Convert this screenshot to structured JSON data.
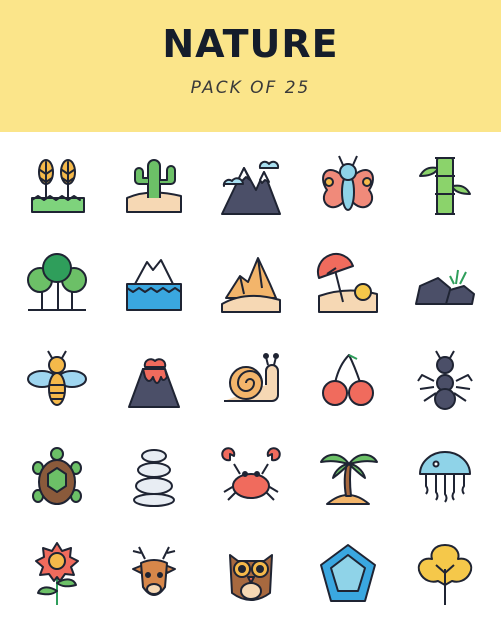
{
  "header": {
    "title": "NATURE",
    "subtitle": "PACK OF 25"
  },
  "colors": {
    "banner": "#fbe58a",
    "outline": "#1f2433",
    "background": "#ffffff"
  },
  "icons": [
    [
      "wheat-icon",
      "cactus-icon",
      "mountain-icon",
      "butterfly-icon",
      "bamboo-icon"
    ],
    [
      "forest-icon",
      "iceberg-icon",
      "desert-dunes-icon",
      "beach-umbrella-icon",
      "rocks-icon"
    ],
    [
      "bee-icon",
      "volcano-icon",
      "snail-icon",
      "cherries-icon",
      "ant-icon"
    ],
    [
      "turtle-icon",
      "stacked-stones-icon",
      "crab-icon",
      "palm-island-icon",
      "jellyfish-icon"
    ],
    [
      "sunflower-icon",
      "deer-icon",
      "owl-icon",
      "gem-icon",
      "leaf-icon"
    ]
  ]
}
